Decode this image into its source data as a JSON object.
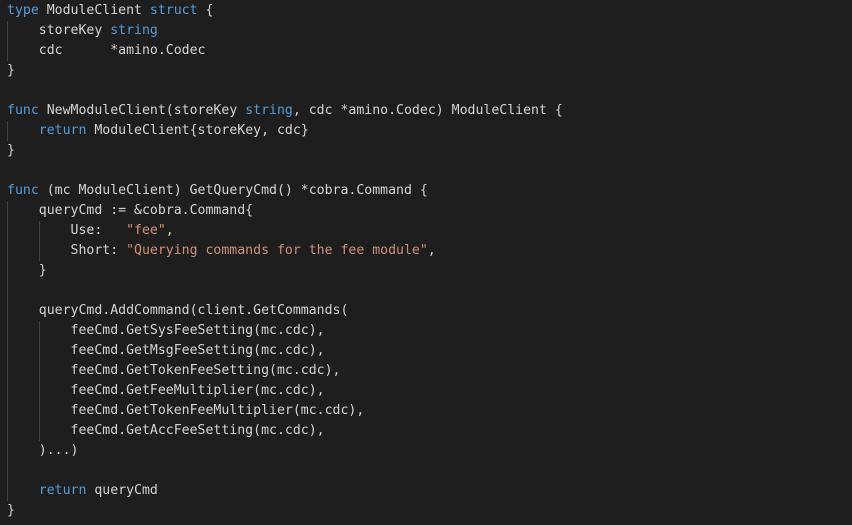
{
  "colors": {
    "background": "#1e1e1e",
    "keyword": "#569cd6",
    "string": "#ce9178",
    "text": "#d4d4d4",
    "indent_guide": "#404040"
  },
  "code": {
    "lines": [
      [
        {
          "t": "type",
          "k": "kw"
        },
        {
          "t": " ModuleClient ",
          "k": "plain"
        },
        {
          "t": "struct",
          "k": "kw"
        },
        {
          "t": " {",
          "k": "plain"
        }
      ],
      [
        {
          "t": "    storeKey ",
          "k": "plain"
        },
        {
          "t": "string",
          "k": "kw"
        }
      ],
      [
        {
          "t": "    cdc      *amino.Codec",
          "k": "plain"
        }
      ],
      [
        {
          "t": "}",
          "k": "plain"
        }
      ],
      [],
      [
        {
          "t": "func",
          "k": "kw"
        },
        {
          "t": " NewModuleClient(storeKey ",
          "k": "plain"
        },
        {
          "t": "string",
          "k": "kw"
        },
        {
          "t": ", cdc *amino.Codec) ModuleClient {",
          "k": "plain"
        }
      ],
      [
        {
          "t": "    ",
          "k": "plain"
        },
        {
          "t": "return",
          "k": "kw"
        },
        {
          "t": " ModuleClient{storeKey, cdc}",
          "k": "plain"
        }
      ],
      [
        {
          "t": "}",
          "k": "plain"
        }
      ],
      [],
      [
        {
          "t": "func",
          "k": "kw"
        },
        {
          "t": " (mc ModuleClient) GetQueryCmd() *cobra.Command {",
          "k": "plain"
        }
      ],
      [
        {
          "t": "    queryCmd := &cobra.Command{",
          "k": "plain"
        }
      ],
      [
        {
          "t": "        Use:   ",
          "k": "plain"
        },
        {
          "t": "\"fee\"",
          "k": "str"
        },
        {
          "t": ",",
          "k": "plain"
        }
      ],
      [
        {
          "t": "        Short: ",
          "k": "plain"
        },
        {
          "t": "\"Querying commands for the fee module\"",
          "k": "str"
        },
        {
          "t": ",",
          "k": "plain"
        }
      ],
      [
        {
          "t": "    }",
          "k": "plain"
        }
      ],
      [],
      [
        {
          "t": "    queryCmd.AddCommand(client.GetCommands(",
          "k": "plain"
        }
      ],
      [
        {
          "t": "        feeCmd.GetSysFeeSetting(mc.cdc),",
          "k": "plain"
        }
      ],
      [
        {
          "t": "        feeCmd.GetMsgFeeSetting(mc.cdc),",
          "k": "plain"
        }
      ],
      [
        {
          "t": "        feeCmd.GetTokenFeeSetting(mc.cdc),",
          "k": "plain"
        }
      ],
      [
        {
          "t": "        feeCmd.GetFeeMultiplier(mc.cdc),",
          "k": "plain"
        }
      ],
      [
        {
          "t": "        feeCmd.GetTokenFeeMultiplier(mc.cdc),",
          "k": "plain"
        }
      ],
      [
        {
          "t": "        feeCmd.GetAccFeeSetting(mc.cdc),",
          "k": "plain"
        }
      ],
      [
        {
          "t": "    )...)",
          "k": "plain"
        }
      ],
      [],
      [
        {
          "t": "    ",
          "k": "plain"
        },
        {
          "t": "return",
          "k": "kw"
        },
        {
          "t": " queryCmd",
          "k": "plain"
        }
      ],
      [
        {
          "t": "}",
          "k": "plain"
        }
      ]
    ]
  }
}
